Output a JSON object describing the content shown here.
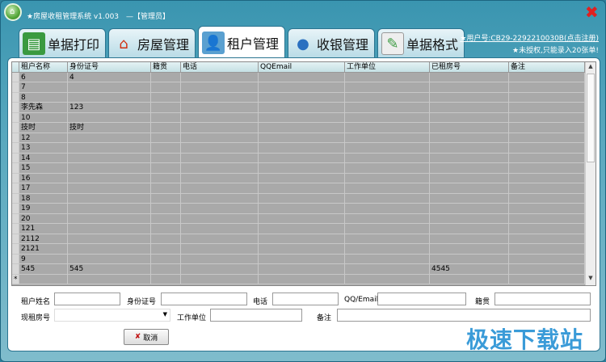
{
  "window": {
    "title": "★房屋收租管理系统 v1.003　—【管理员】",
    "close_icon": "close-x-icon"
  },
  "tabs": [
    {
      "label": "单据打印",
      "icon": "printer-icon",
      "active": false
    },
    {
      "label": "房屋管理",
      "icon": "house-icon",
      "active": false
    },
    {
      "label": "租户管理",
      "icon": "person-icon",
      "active": true
    },
    {
      "label": "收银管理",
      "icon": "cashier-icon",
      "active": false
    },
    {
      "label": "单据格式",
      "icon": "edit-form-icon",
      "active": false
    }
  ],
  "user": {
    "id_link": "★用户号:CB29-2292210030B(点击注册)",
    "notice": "★未授权,只能录入20张单!"
  },
  "table": {
    "columns": [
      "租户名称",
      "身份证号",
      "籍贯",
      "电话",
      "QQEmail",
      "工作单位",
      "已租房号",
      "备注"
    ],
    "rows": [
      [
        "6",
        "4",
        "",
        "",
        "",
        "",
        "",
        ""
      ],
      [
        "7",
        "",
        "",
        "",
        "",
        "",
        "",
        ""
      ],
      [
        "8",
        "",
        "",
        "",
        "",
        "",
        "",
        ""
      ],
      [
        "李先森",
        "123",
        "",
        "",
        "",
        "",
        "",
        ""
      ],
      [
        "10",
        "",
        "",
        "",
        "",
        "",
        "",
        ""
      ],
      [
        "技时",
        "技时",
        "",
        "",
        "",
        "",
        "",
        ""
      ],
      [
        "12",
        "",
        "",
        "",
        "",
        "",
        "",
        ""
      ],
      [
        "13",
        "",
        "",
        "",
        "",
        "",
        "",
        ""
      ],
      [
        "14",
        "",
        "",
        "",
        "",
        "",
        "",
        ""
      ],
      [
        "15",
        "",
        "",
        "",
        "",
        "",
        "",
        ""
      ],
      [
        "16",
        "",
        "",
        "",
        "",
        "",
        "",
        ""
      ],
      [
        "17",
        "",
        "",
        "",
        "",
        "",
        "",
        ""
      ],
      [
        "18",
        "",
        "",
        "",
        "",
        "",
        "",
        ""
      ],
      [
        "19",
        "",
        "",
        "",
        "",
        "",
        "",
        ""
      ],
      [
        "20",
        "",
        "",
        "",
        "",
        "",
        "",
        ""
      ],
      [
        "121",
        "",
        "",
        "",
        "",
        "",
        "",
        ""
      ],
      [
        "2112",
        "",
        "",
        "",
        "",
        "",
        "",
        ""
      ],
      [
        "2121",
        "",
        "",
        "",
        "",
        "",
        "",
        ""
      ],
      [
        "9",
        "",
        "",
        "",
        "",
        "",
        "",
        ""
      ],
      [
        "545",
        "545",
        "",
        "",
        "",
        "",
        "4545",
        ""
      ]
    ],
    "new_row_marker": "*"
  },
  "form": {
    "name": "租户姓名",
    "id": "身份证号",
    "phone": "电话",
    "qq": "QQ/Email",
    "origin": "籍贯",
    "room": "现租房号",
    "work": "工作单位",
    "note": "备注",
    "cancel": "取消"
  },
  "watermark": "极速下载站"
}
